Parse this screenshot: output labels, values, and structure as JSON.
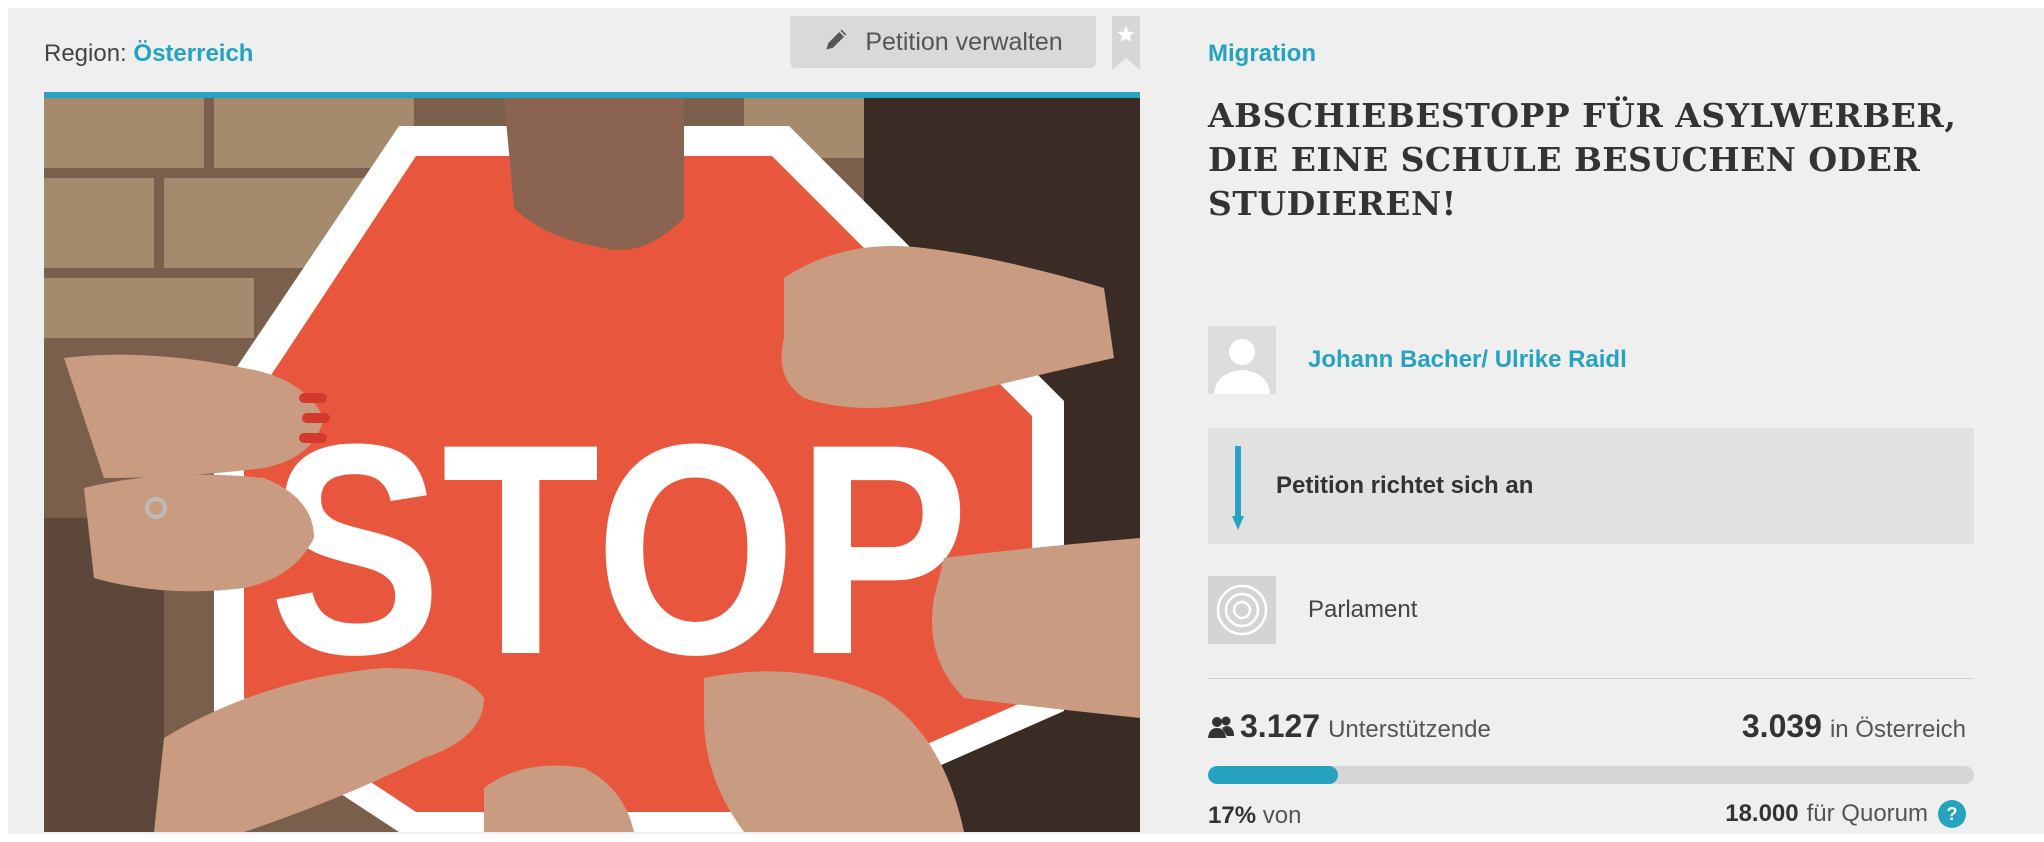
{
  "region": {
    "label": "Region:",
    "value": "Österreich"
  },
  "toolbar": {
    "manage_label": "Petition verwalten",
    "manage_icon": "pencil-icon",
    "bookmark_icon": "star-bookmark-icon"
  },
  "image": {
    "sign_text": "STOP"
  },
  "petition": {
    "category": "Migration",
    "title": "ABSCHIEBESTOPP FÜR ASYLWERBER, DIE EINE SCHULE BESUCHEN ODER STUDIEREN!",
    "author": "Johann Bacher/ Ulrike Raidl",
    "addressee_label": "Petition richtet sich an",
    "recipient": "Parlament"
  },
  "stats": {
    "supporters": "3.127",
    "supporters_label": "Unterstützende",
    "in_country": "3.039",
    "in_country_label": "in Österreich",
    "percent": "17%",
    "percent_label": "von",
    "progress_fraction": 0.17,
    "quorum": "18.000",
    "quorum_label": "für Quorum",
    "help_symbol": "?"
  },
  "colors": {
    "accent": "#26a3c1",
    "panel": "#efefef",
    "sign_red": "#e8573d"
  }
}
